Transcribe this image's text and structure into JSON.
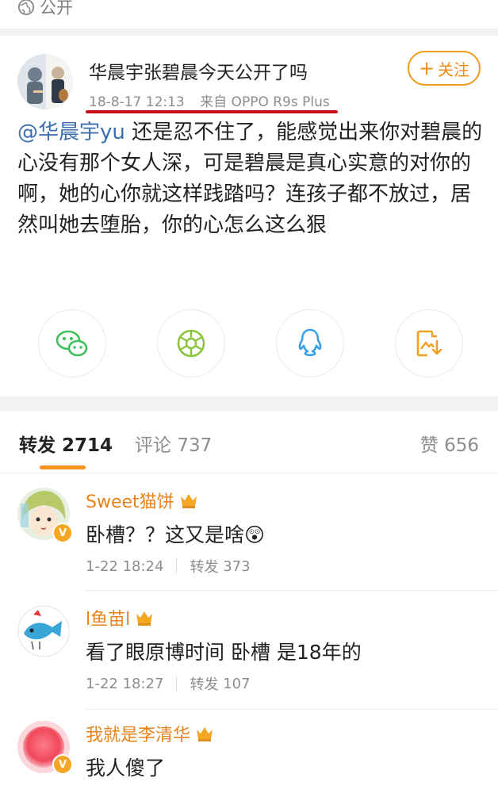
{
  "visibility": {
    "label": "公开"
  },
  "post": {
    "author": "华晨宇张碧晨今天公开了吗",
    "time": "18-8-17 12:13",
    "source": "来自 OPPO R9s Plus",
    "follow_label": "关注",
    "mention": "@华晨宇yu",
    "body": " 还是忍不住了，能感觉出来你对碧晨的心没有那个女人深，可是碧晨是真心实意的对你的啊，她的心你就这样践踏吗？连孩子都不放过，居然叫她去堕胎，你的心怎么这么狠"
  },
  "share": [
    {
      "icon": "wechat-icon",
      "color": "#3dbf5a"
    },
    {
      "icon": "moments-icon",
      "color": "#8bc53f"
    },
    {
      "icon": "qq-icon",
      "color": "#3aa0e6"
    },
    {
      "icon": "save-image-icon",
      "color": "#f0a020"
    }
  ],
  "tabs": {
    "repost": {
      "label": "转发",
      "count": "2714"
    },
    "comments": {
      "label": "评论",
      "count": "737"
    },
    "likes": {
      "label": "赞",
      "count": "656"
    }
  },
  "reposts": [
    {
      "name": "Sweet猫饼",
      "text": "卧槽？？这又是啥😲",
      "time": "1-22 18:24",
      "repost_label": "转发",
      "repost_count": "373"
    },
    {
      "name": "l鱼苗l",
      "text": "看了眼原博时间 卧槽 是18年的",
      "time": "1-22 18:27",
      "repost_label": "转发",
      "repost_count": "107"
    },
    {
      "name": "我就是李清华",
      "text": "我人傻了",
      "time": "",
      "repost_label": "",
      "repost_count": ""
    }
  ],
  "colors": {
    "accent": "#f7931e",
    "link": "#3b6fb0",
    "underline": "#c8101a"
  }
}
